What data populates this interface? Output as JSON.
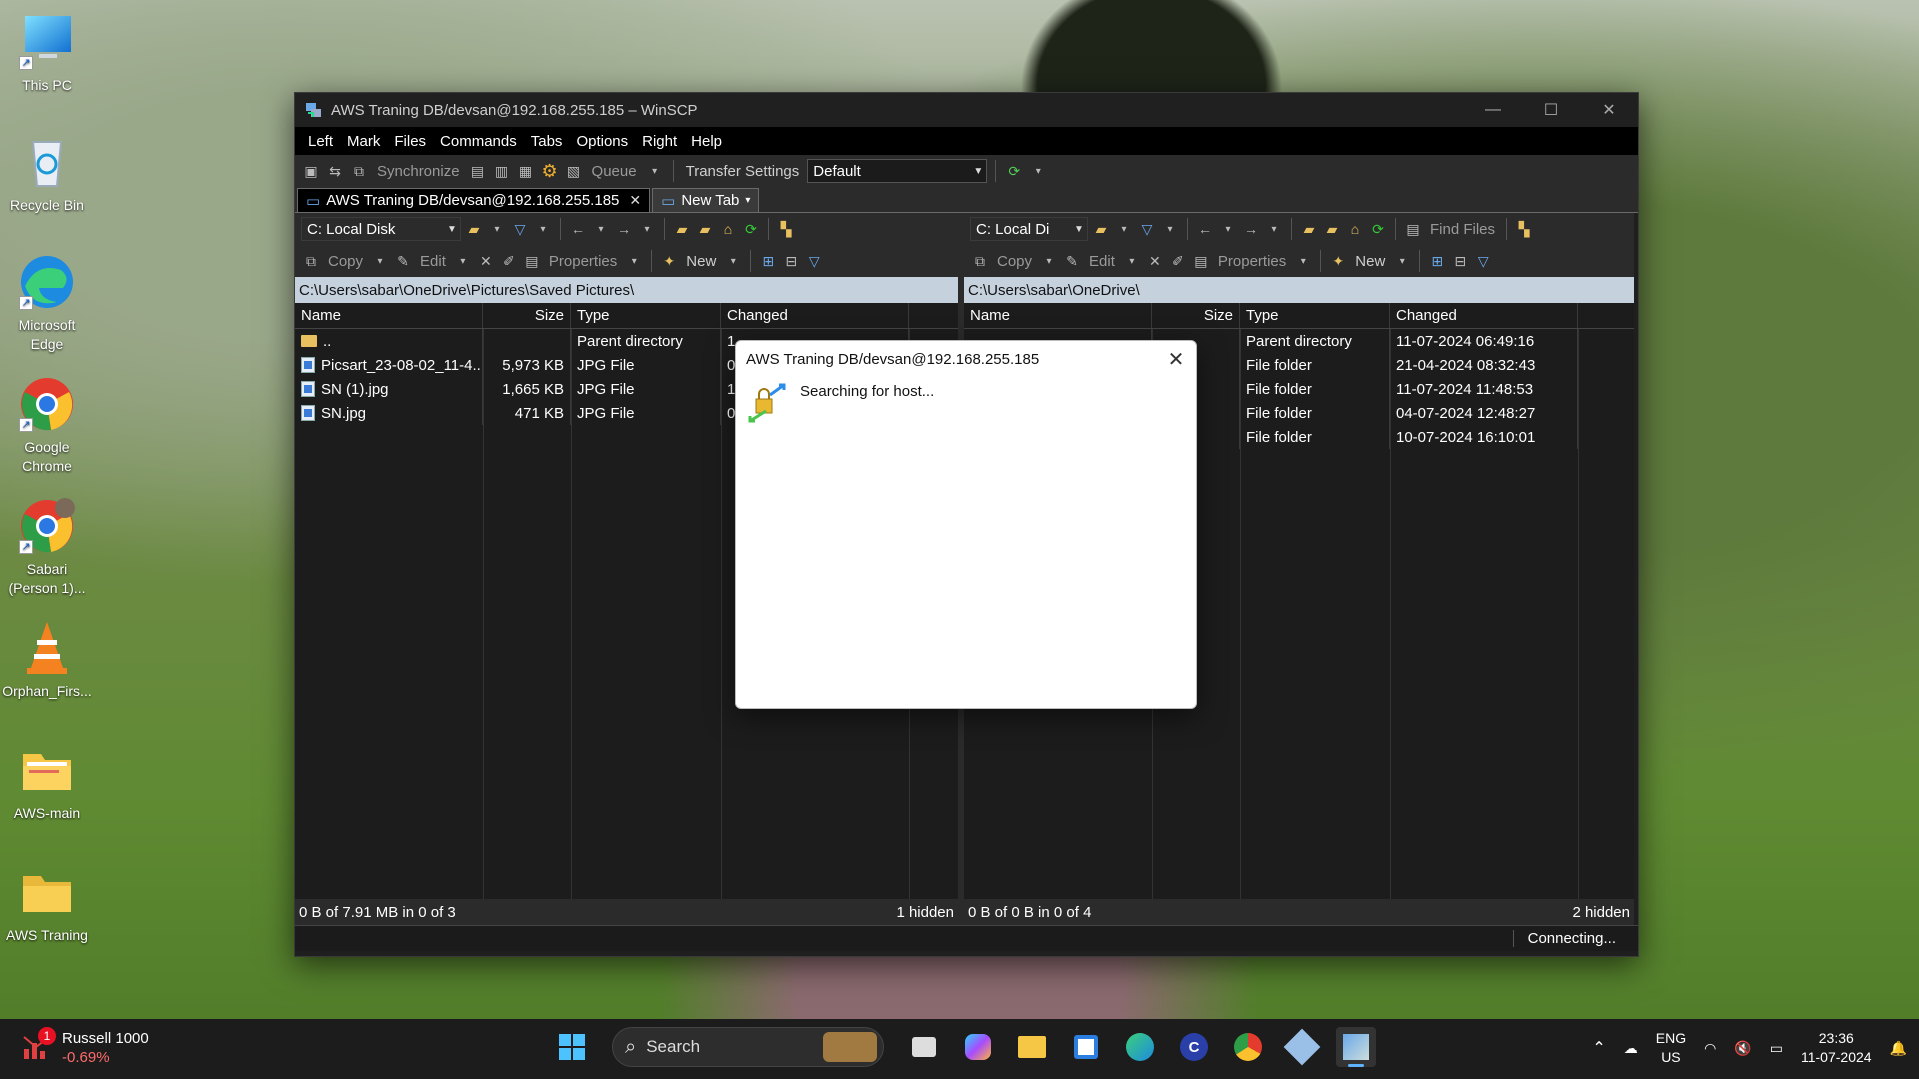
{
  "desktop": {
    "icons": [
      {
        "label": "This PC"
      },
      {
        "label": "Recycle Bin"
      },
      {
        "label": "Microsoft Edge"
      },
      {
        "label": "Google Chrome"
      },
      {
        "label": "Sabari (Person 1)..."
      },
      {
        "label": "Orphan_Firs..."
      },
      {
        "label": "AWS-main"
      },
      {
        "label": "AWS Traning"
      }
    ]
  },
  "window": {
    "title": "AWS Traning DB/devsan@192.168.255.185 – WinSCP",
    "menu": [
      "Left",
      "Mark",
      "Files",
      "Commands",
      "Tabs",
      "Options",
      "Right",
      "Help"
    ],
    "toolbar": {
      "synchronize": "Synchronize",
      "queue": "Queue",
      "transfer_settings": "Transfer Settings",
      "transfer_value": "Default"
    },
    "tabs": [
      {
        "label": "AWS Traning DB/devsan@192.168.255.185"
      },
      {
        "label": "New Tab"
      }
    ],
    "left": {
      "drive": "C: Local Disk",
      "actions": {
        "copy": "Copy",
        "edit": "Edit",
        "properties": "Properties",
        "new": "New"
      },
      "path": "C:\\Users\\sabar\\OneDrive\\Pictures\\Saved Pictures\\",
      "columns": {
        "name": "Name",
        "size": "Size",
        "type": "Type",
        "changed": "Changed"
      },
      "rows": [
        {
          "name": "..",
          "size": "",
          "type": "Parent directory",
          "changed": "1"
        },
        {
          "name": "Picsart_23-08-02_11-4...",
          "size": "5,973 KB",
          "type": "JPG File",
          "changed": "0"
        },
        {
          "name": "SN (1).jpg",
          "size": "1,665 KB",
          "type": "JPG File",
          "changed": "1"
        },
        {
          "name": "SN.jpg",
          "size": "471 KB",
          "type": "JPG File",
          "changed": "0"
        }
      ],
      "status": "0 B of 7.91 MB in 0 of 3",
      "hidden": "1 hidden"
    },
    "right": {
      "drive": "C: Local Di",
      "find_files": "Find Files",
      "actions": {
        "copy": "Copy",
        "edit": "Edit",
        "properties": "Properties",
        "new": "New"
      },
      "path": "C:\\Users\\sabar\\OneDrive\\",
      "columns": {
        "name": "Name",
        "size": "Size",
        "type": "Type",
        "changed": "Changed"
      },
      "rows": [
        {
          "type": "Parent directory",
          "changed": "11-07-2024 06:49:16"
        },
        {
          "type": "File folder",
          "changed": "21-04-2024 08:32:43"
        },
        {
          "type": "File folder",
          "changed": "11-07-2024 11:48:53"
        },
        {
          "type": "File folder",
          "changed": "04-07-2024 12:48:27"
        },
        {
          "type": "File folder",
          "changed": "10-07-2024 16:10:01"
        }
      ],
      "status": "0 B of 0 B in 0 of 4",
      "hidden": "2 hidden"
    },
    "connection_status": "Connecting..."
  },
  "dialog": {
    "title": "AWS Traning DB/devsan@192.168.255.185",
    "message": "Searching for host..."
  },
  "taskbar": {
    "widget": {
      "title": "Russell 1000",
      "change": "-0.69%",
      "badge": "1"
    },
    "search_placeholder": "Search",
    "language": {
      "line1": "ENG",
      "line2": "US"
    },
    "time": "23:36",
    "date": "11-07-2024"
  }
}
